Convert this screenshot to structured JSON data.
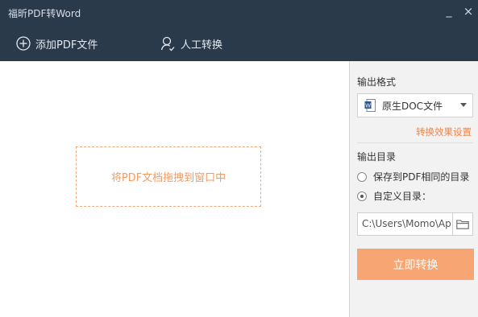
{
  "window": {
    "title": "福昕PDF转Word",
    "minimize": "_",
    "close": "×"
  },
  "toolbar": {
    "add_pdf": "添加PDF文件",
    "manual_convert": "人工转换"
  },
  "drop_area": {
    "hint": "将PDF文档拖拽到窗口中"
  },
  "panel": {
    "output_format_label": "输出格式",
    "format_selected": "原生DOC文件",
    "effect_settings_link": "转换效果设置",
    "output_dir_label": "输出目录",
    "radio_same_dir": "保存到PDF相同的目录",
    "radio_custom_dir": "自定义目录：",
    "path_value": "C:\\Users\\Momo\\Ap",
    "convert_button": "立即转换"
  },
  "colors": {
    "accent": "#f7a572",
    "titlebar": "#2b3a4a",
    "link": "#f0844a"
  }
}
